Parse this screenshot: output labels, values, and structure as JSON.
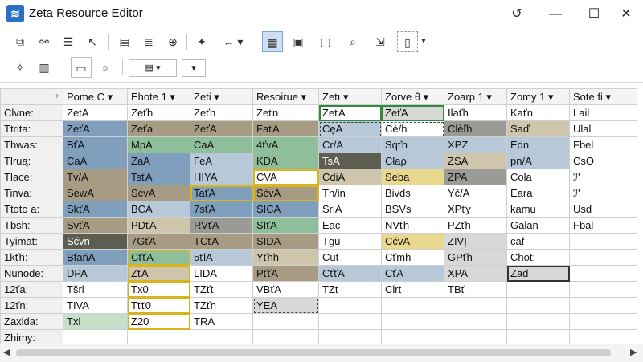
{
  "window": {
    "title": "Zeta Resource Editor",
    "controls": {
      "restore": "↺",
      "minimize": "—",
      "maximize": "☐",
      "close": "✕"
    }
  },
  "toolbar1": [
    "copy-icon",
    "link-icon",
    "align-icon",
    "pointer-icon",
    "layout-icon",
    "stack-icon",
    "zoom-icon",
    "magic-icon",
    "arrow-icon",
    "grid-icon",
    "image-icon",
    "frame-icon",
    "find-image-icon",
    "export-icon",
    "device-icon"
  ],
  "toolbar2": {
    "dropdown_arrow": "▾"
  },
  "grid": {
    "corner": "+",
    "columns": [
      "Pome C",
      "Ehote 1",
      "Zeti",
      "Resoirue",
      "Zetı",
      "Zorve θ",
      "Zoarp 1",
      "Zomy 1",
      "Sote fi"
    ],
    "column_widths": [
      78,
      78,
      78,
      82,
      78,
      78,
      78,
      78,
      82
    ],
    "row_height": 20,
    "colors": {
      "b": "#7f9fbc",
      "bl": "#b7c9d9",
      "g": "#8fbf9a",
      "gl": "#c5dfc8",
      "t": "#a89b83",
      "tl": "#cfc5ad",
      "dk": "#5d5d52",
      "gr": "#9a9a96",
      "gy": "#d8d8d8",
      "y": "#e8d98e"
    },
    "rows": [
      {
        "h": "Clvne:",
        "cells": [
          {
            "t": "ZetA"
          },
          {
            "t": "Zeťh"
          },
          {
            "t": "Zeťh"
          },
          {
            "t": "Zeťn"
          },
          {
            "t": "ZeťA",
            "b": "green"
          },
          {
            "t": "ZeťA",
            "c": "gy",
            "b": "green"
          },
          {
            "t": "Ilaťh"
          },
          {
            "t": "Kaťn"
          },
          {
            "t": "Lail"
          }
        ]
      },
      {
        "h": "Ttrita:",
        "cells": [
          {
            "t": "ZeťA",
            "c": "b"
          },
          {
            "t": "Zeťa",
            "c": "t"
          },
          {
            "t": "ZeťA",
            "c": "t"
          },
          {
            "t": "FaťA",
            "c": "t"
          },
          {
            "t": "CęA",
            "c": "bl",
            "b": "dash"
          },
          {
            "t": "Cè/h",
            "b": "dash"
          },
          {
            "t": "Clèľh",
            "c": "gr"
          },
          {
            "t": "Saď",
            "c": "tl"
          },
          {
            "t": "Ulal"
          }
        ]
      },
      {
        "h": "Thwas:",
        "cells": [
          {
            "t": "BťA",
            "c": "b"
          },
          {
            "t": "MpA",
            "c": "g"
          },
          {
            "t": "CaA",
            "c": "g"
          },
          {
            "t": "4ťvA",
            "c": "g"
          },
          {
            "t": "Cr/A",
            "c": "bl"
          },
          {
            "t": "Sqťh",
            "c": "bl"
          },
          {
            "t": "XPZ",
            "c": "bl"
          },
          {
            "t": "Edn",
            "c": "bl"
          },
          {
            "t": "Fbel"
          }
        ]
      },
      {
        "h": "Tlruą:",
        "cells": [
          {
            "t": "CaA",
            "c": "b"
          },
          {
            "t": "ZaA",
            "c": "b"
          },
          {
            "t": "ΓeA",
            "c": "bl"
          },
          {
            "t": "KDA",
            "c": "g"
          },
          {
            "t": "TsA",
            "c": "dk"
          },
          {
            "t": "Cłaρ",
            "c": "bl"
          },
          {
            "t": "ZSA",
            "c": "tl"
          },
          {
            "t": "pn/A",
            "c": "bl"
          },
          {
            "t": "CsO"
          }
        ]
      },
      {
        "h": "Tlace:",
        "cells": [
          {
            "t": "Tv/A",
            "c": "t"
          },
          {
            "t": "TsťA",
            "c": "b"
          },
          {
            "t": "HIYA",
            "c": "bl"
          },
          {
            "t": "CVA",
            "b": "yellow"
          },
          {
            "t": "CdiA",
            "c": "tl"
          },
          {
            "t": "Seba",
            "c": "y"
          },
          {
            "t": "ZPA",
            "c": "gr"
          },
          {
            "t": "Cola"
          },
          {
            "t": "ℐ'"
          }
        ]
      },
      {
        "h": "Tinva:",
        "cells": [
          {
            "t": "SewA",
            "c": "t"
          },
          {
            "t": "SćvA",
            "c": "t"
          },
          {
            "t": "TaťA",
            "c": "b",
            "b": "yellow"
          },
          {
            "t": "SćvA",
            "c": "t",
            "b": "yellow"
          },
          {
            "t": "Th/in"
          },
          {
            "t": "Bivds"
          },
          {
            "t": "Yč/A"
          },
          {
            "t": "Eara"
          },
          {
            "t": "ℐ'"
          }
        ]
      },
      {
        "h": "Ttoto a:",
        "cells": [
          {
            "t": "SkťA",
            "c": "b"
          },
          {
            "t": "BCA",
            "c": "bl"
          },
          {
            "t": "7sťA",
            "c": "b"
          },
          {
            "t": "SICA",
            "c": "b"
          },
          {
            "t": "SrlA"
          },
          {
            "t": "BSVs"
          },
          {
            "t": "XPťy"
          },
          {
            "t": "kamu"
          },
          {
            "t": "Usď"
          }
        ]
      },
      {
        "h": "Tbsh:",
        "cells": [
          {
            "t": "SvťA",
            "c": "t"
          },
          {
            "t": "PDťA",
            "c": "tl"
          },
          {
            "t": "RVťA",
            "c": "gr"
          },
          {
            "t": "SIťA",
            "c": "g"
          },
          {
            "t": "Eac"
          },
          {
            "t": "NVťh"
          },
          {
            "t": "PZťh"
          },
          {
            "t": "Galan"
          },
          {
            "t": "Fbal"
          }
        ]
      },
      {
        "h": "Tyimat:",
        "cells": [
          {
            "t": "Sćvn",
            "c": "dk"
          },
          {
            "t": "7GťA",
            "c": "t"
          },
          {
            "t": "TCťA",
            "c": "t"
          },
          {
            "t": "SIDA",
            "c": "t"
          },
          {
            "t": "Tgu"
          },
          {
            "t": "CćvA",
            "c": "y"
          },
          {
            "t": "ZIVĮ",
            "c": "gy"
          },
          {
            "t": "caf"
          },
          {
            "t": ""
          }
        ]
      },
      {
        "h": "1kťh:",
        "cells": [
          {
            "t": "BfańA",
            "c": "b"
          },
          {
            "t": "CťťA",
            "c": "g",
            "b": "yellow"
          },
          {
            "t": "5ťlA",
            "c": "bl"
          },
          {
            "t": "Yťhh",
            "c": "tl"
          },
          {
            "t": "Cut"
          },
          {
            "t": "Cťmh"
          },
          {
            "t": "GPťh",
            "c": "gy"
          },
          {
            "t": "Chot:"
          },
          {
            "t": ""
          }
        ]
      },
      {
        "h": "Nunode:",
        "cells": [
          {
            "t": "DPA",
            "c": "bl"
          },
          {
            "t": "ZťA",
            "c": "tl",
            "b": "yellow"
          },
          {
            "t": "LIDA"
          },
          {
            "t": "PťťA",
            "c": "t"
          },
          {
            "t": "CťťA",
            "c": "bl"
          },
          {
            "t": "CťA",
            "c": "bl"
          },
          {
            "t": "XPA",
            "c": "gy"
          },
          {
            "t": "Zad",
            "c": "gy",
            "b": "dark"
          },
          {
            "t": ""
          }
        ]
      },
      {
        "h": "12ťa:",
        "cells": [
          {
            "t": "Tšrl"
          },
          {
            "t": "Tx0",
            "b": "yellow"
          },
          {
            "t": "TZťt"
          },
          {
            "t": "VBťA"
          },
          {
            "t": "TZt"
          },
          {
            "t": "Clrt"
          },
          {
            "t": "TBť"
          },
          {
            "t": ""
          },
          {
            "t": ""
          }
        ]
      },
      {
        "h": "12ťn:",
        "cells": [
          {
            "t": "TIVA"
          },
          {
            "t": "Tťť0",
            "b": "yellow"
          },
          {
            "t": "TZťn"
          },
          {
            "t": "YEA",
            "c": "gy",
            "b": "dash"
          },
          {
            "t": ""
          },
          {
            "t": ""
          },
          {
            "t": ""
          },
          {
            "t": ""
          },
          {
            "t": ""
          }
        ]
      },
      {
        "h": "Zaxlda:",
        "cells": [
          {
            "t": "Txl",
            "c": "gl"
          },
          {
            "t": "Z20",
            "b": "yellow"
          },
          {
            "t": "TRA"
          },
          {
            "t": ""
          },
          {
            "t": ""
          },
          {
            "t": ""
          },
          {
            "t": ""
          },
          {
            "t": ""
          },
          {
            "t": ""
          }
        ]
      },
      {
        "h": "Zhimy:",
        "cells": [
          {
            "t": ""
          },
          {
            "t": ""
          },
          {
            "t": ""
          },
          {
            "t": ""
          },
          {
            "t": ""
          },
          {
            "t": ""
          },
          {
            "t": ""
          },
          {
            "t": ""
          },
          {
            "t": ""
          }
        ]
      }
    ]
  },
  "scrollbar": {
    "left": "◀",
    "right": "▶"
  }
}
